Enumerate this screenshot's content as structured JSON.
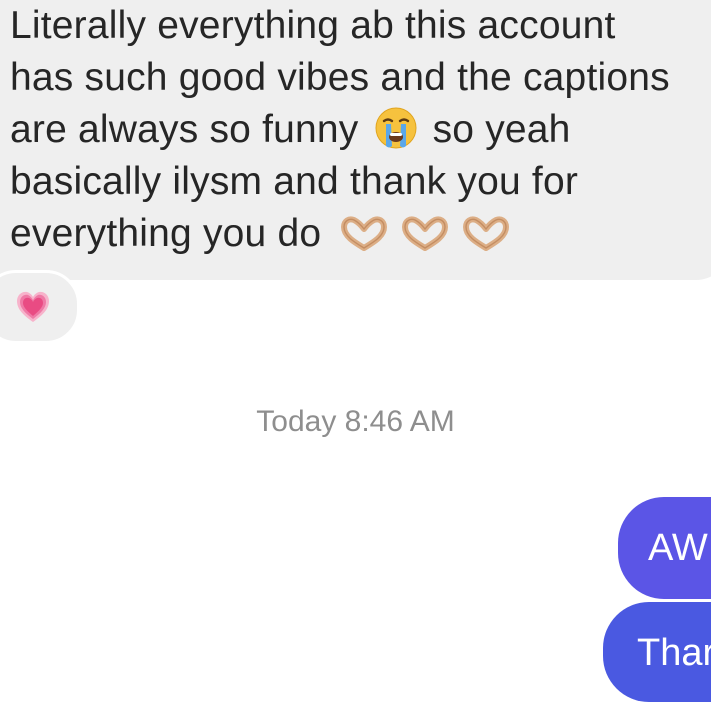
{
  "incoming_message": {
    "lines": [
      "Literally everything ab this account",
      "has such good vibes and the captions",
      "are always so funny",
      "so yeah",
      "basically ilysm and thank you for",
      "everything you do"
    ],
    "emojis": [
      "loudly-crying-face-icon",
      "heart-hands-icon",
      "heart-hands-icon",
      "heart-hands-icon"
    ],
    "reaction": "growing-heart-icon"
  },
  "timestamp": "Today 8:46 AM",
  "outgoing_messages": [
    {
      "text": "AW"
    },
    {
      "text": "Thar"
    }
  ],
  "colors": {
    "incoming_bubble": "#efefef",
    "incoming_text": "#262626",
    "timestamp": "#8e8e8e",
    "outgoing_top": "#5b55e6",
    "outgoing_bottom": "#4a59e1",
    "heart": "#ef5b8e"
  }
}
